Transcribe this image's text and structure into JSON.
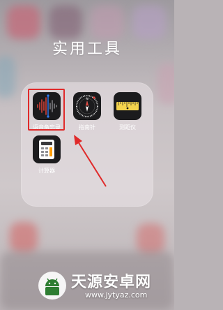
{
  "folder": {
    "title": "实用工具",
    "apps": [
      {
        "label": "语音备忘录",
        "icon": "voice-memos-icon"
      },
      {
        "label": "指南针",
        "icon": "compass-icon"
      },
      {
        "label": "测距仪",
        "icon": "measure-icon"
      },
      {
        "label": "计算器",
        "icon": "calculator-icon"
      }
    ]
  },
  "annotation": {
    "color": "#e02a2a"
  },
  "watermark": {
    "title": "天源安卓网",
    "url": "www.jytyaz.com",
    "logo": "android-robot-icon",
    "brand_color": "#2e7d32"
  }
}
